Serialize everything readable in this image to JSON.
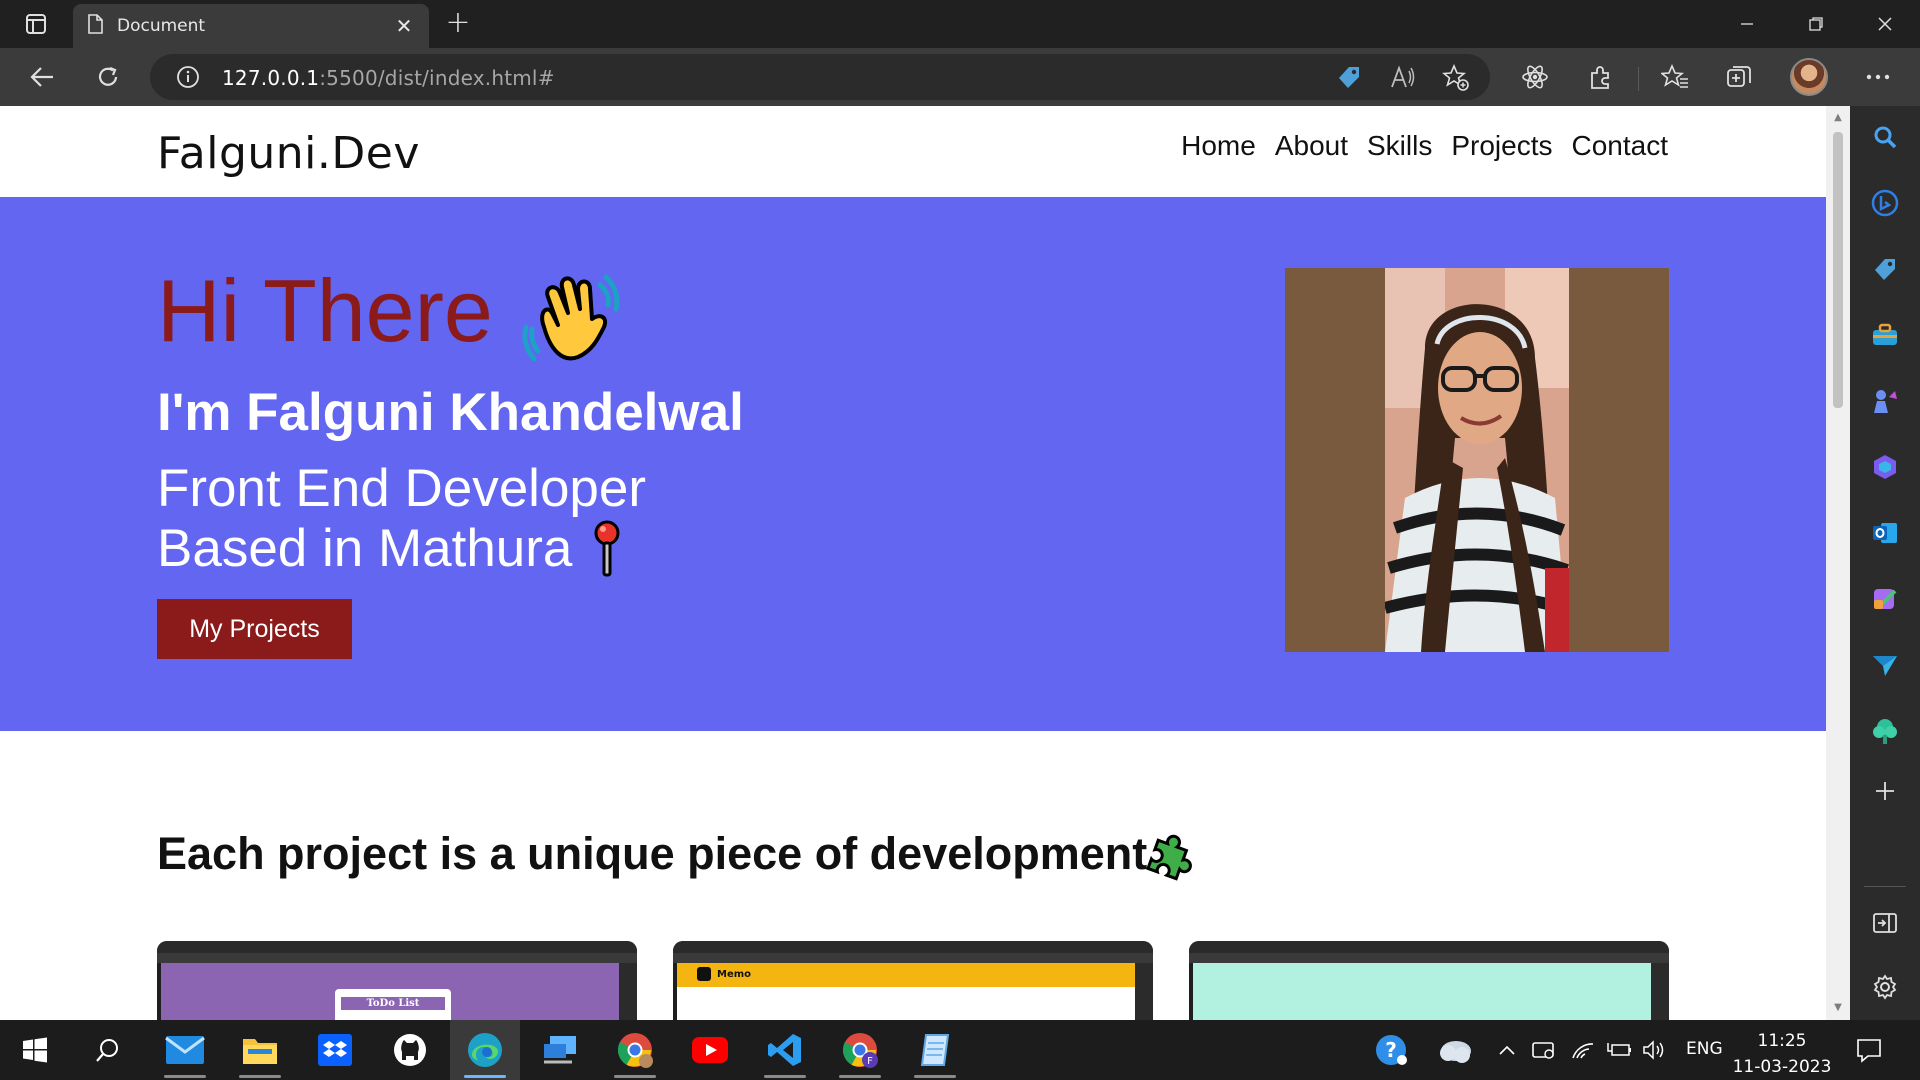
{
  "browser": {
    "tab_title": "Document",
    "url_host": "127.0.0.1",
    "url_rest": ":5500/dist/index.html#"
  },
  "site": {
    "logo": "Falguni.Dev",
    "nav": [
      "Home",
      "About",
      "Skills",
      "Projects",
      "Contact"
    ],
    "hero": {
      "greeting": "Hi There",
      "name": "I'm Falguni Khandelwal",
      "role_line1": "Front End Developer",
      "role_line2": "Based in Mathura",
      "cta": "My Projects"
    },
    "projects_title": "Each project is a unique piece of development",
    "cards": [
      {
        "label": "ToDo List"
      },
      {
        "label": "Memo"
      },
      {
        "label": ""
      }
    ]
  },
  "taskbar": {
    "language": "ENG",
    "time": "11:25",
    "date": "11-03-2023"
  },
  "colors": {
    "hero_bg": "#6366f1",
    "accent": "#8b1a1a"
  }
}
